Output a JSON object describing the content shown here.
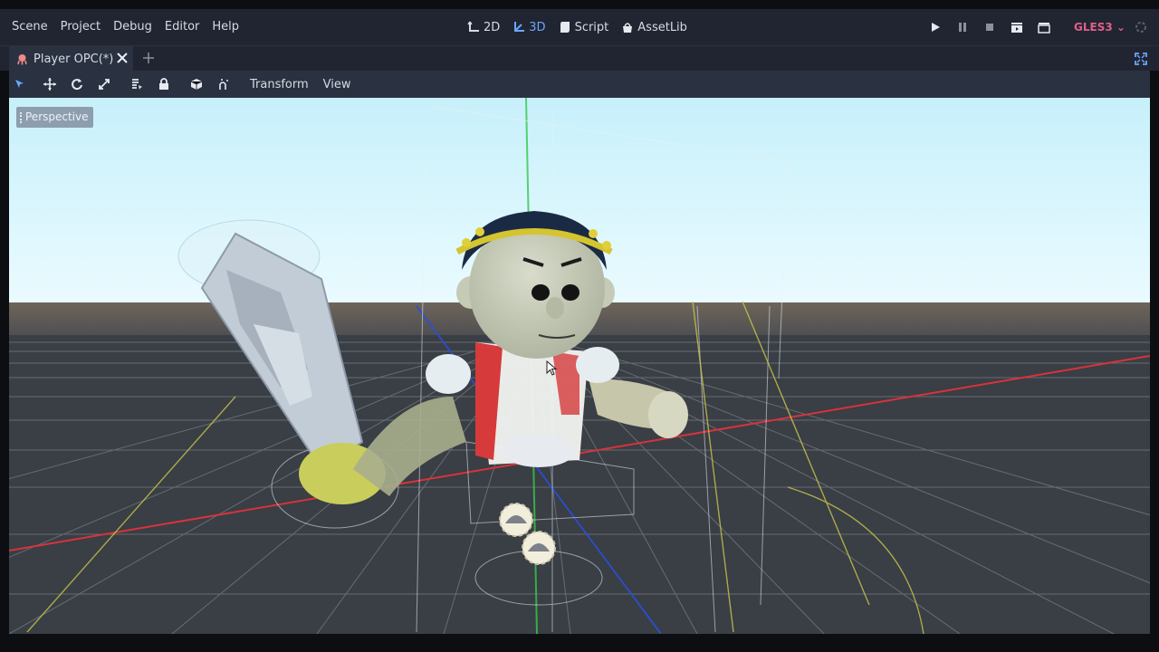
{
  "menu": [
    "Scene",
    "Project",
    "Debug",
    "Editor",
    "Help"
  ],
  "workspaces": [
    {
      "label": "2D",
      "icon": "2d-icon",
      "active": false
    },
    {
      "label": "3D",
      "icon": "3d-icon",
      "active": true
    },
    {
      "label": "Script",
      "icon": "script-icon",
      "active": false
    },
    {
      "label": "AssetLib",
      "icon": "assetlib-icon",
      "active": false
    }
  ],
  "renderer": "GLES3",
  "scene_tab": {
    "label": "Player OPC(*)"
  },
  "toolbar": {
    "transform_label": "Transform",
    "view_label": "View"
  },
  "viewport": {
    "mode_label": "Perspective"
  },
  "colors": {
    "accent": "#6aa7ff",
    "renderer": "#e0608a",
    "panel": "#202531",
    "toolbar": "#2a3141",
    "sky": "#d9f6fd",
    "ground": "#3a3e45",
    "x_axis": "#d8333a",
    "y_axis": "#35c94b",
    "z_axis": "#2b4fd8"
  }
}
